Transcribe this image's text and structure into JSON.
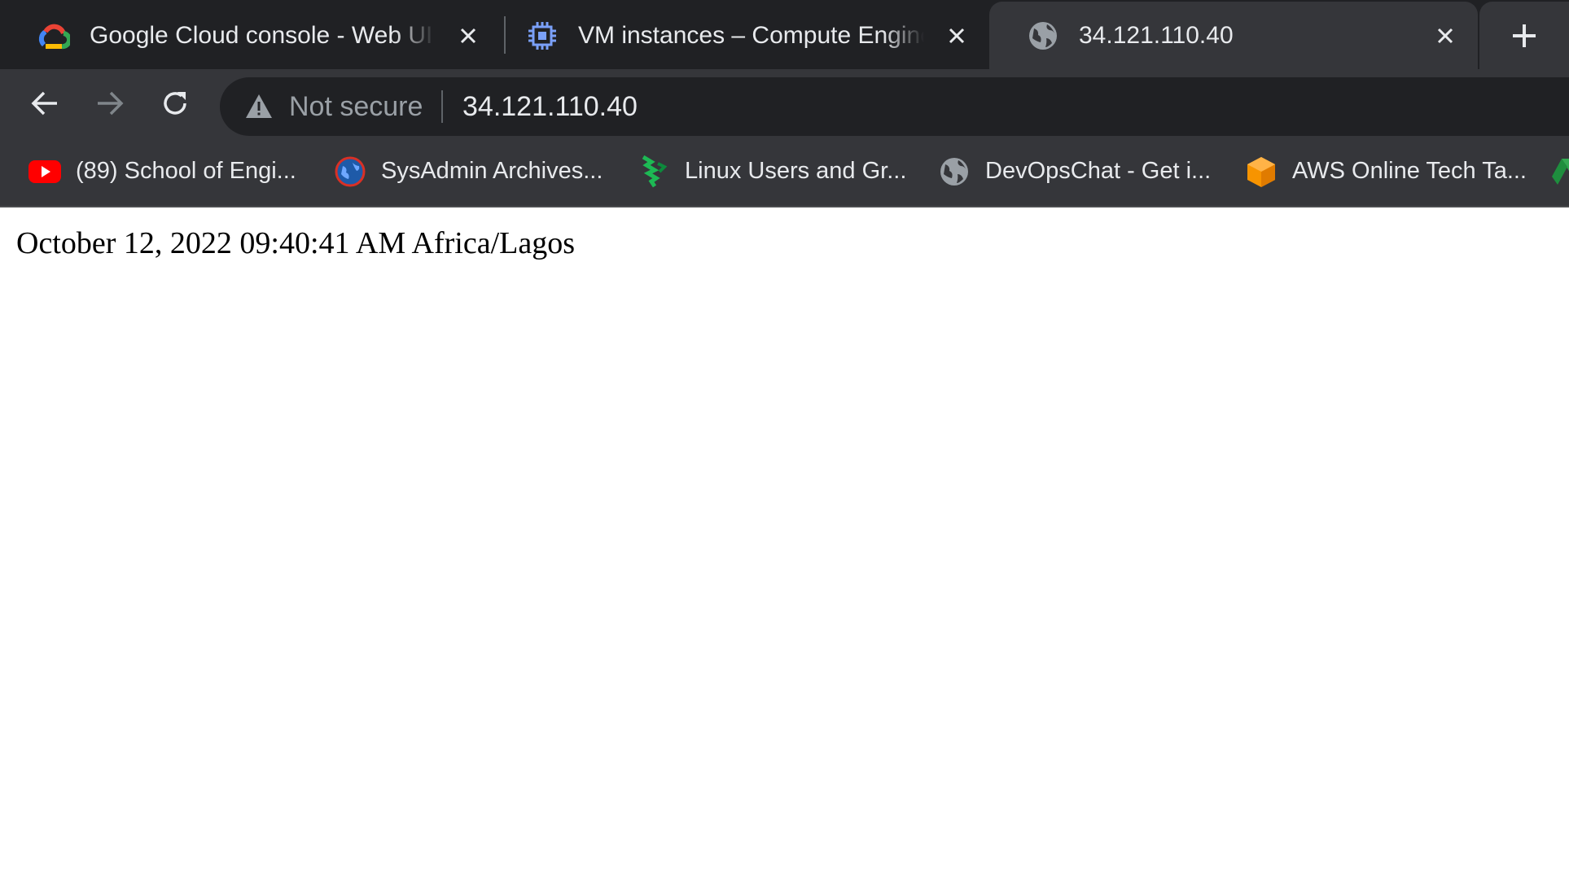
{
  "browser": {
    "tabs": [
      {
        "title": "Google Cloud console - Web UI Admin",
        "favicon": "google-cloud-icon",
        "active": false
      },
      {
        "title": "VM instances – Compute Engine – My First Project",
        "favicon": "compute-engine-chip-icon",
        "active": false
      },
      {
        "title": "34.121.110.40",
        "favicon": "globe-icon",
        "active": true
      }
    ],
    "omnibox": {
      "security_label": "Not secure",
      "url": "34.121.110.40"
    },
    "bookmarks": [
      {
        "label": "(89) School of Engi...",
        "icon": "youtube-icon"
      },
      {
        "label": "SysAdmin Archives...",
        "icon": "sysadmin-globe-icon"
      },
      {
        "label": "Linux Users and Gr...",
        "icon": "linux-users-icon"
      },
      {
        "label": "DevOpsChat - Get i...",
        "icon": "globe-icon"
      },
      {
        "label": "AWS Online Tech Ta...",
        "icon": "aws-box-icon"
      }
    ]
  },
  "page": {
    "datetime_text": "October 12, 2022 09:40:41 AM Africa/Lagos"
  },
  "colors": {
    "tabstrip_bg": "#202124",
    "toolbar_bg": "#35363a",
    "omnibox_bg": "#202124",
    "text_light": "#e8eaed",
    "text_muted": "#9aa0a6",
    "youtube_red": "#ff0000",
    "aws_orange": "#f79400",
    "linux_green": "#1db954"
  }
}
